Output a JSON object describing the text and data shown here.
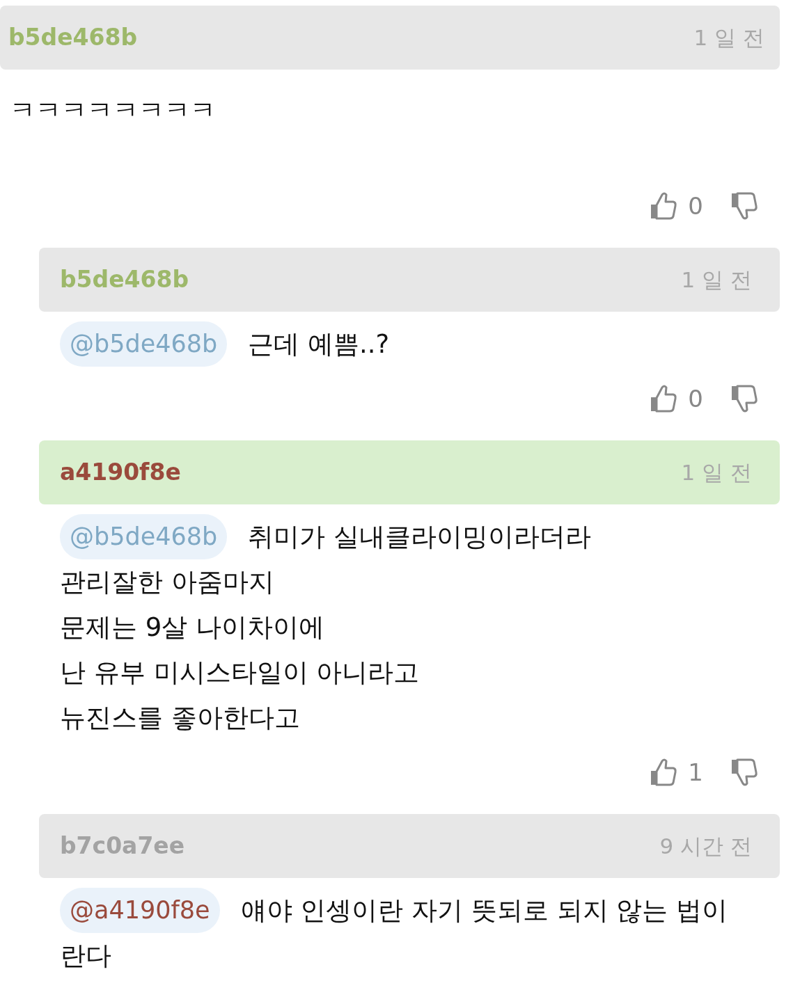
{
  "comments": [
    {
      "author": "b5de468b",
      "color": "#9db86a",
      "time": "1 일 전",
      "reply": false,
      "highlighted": false,
      "lines": [
        "ㅋㅋㅋㅋㅋㅋㅋㅋ"
      ],
      "likes": "0"
    },
    {
      "author": "b5de468b",
      "color": "#9db86a",
      "time": "1 일 전",
      "reply": true,
      "highlighted": false,
      "mention": {
        "text": "@b5de468b",
        "color": "#7fa8c4"
      },
      "lines": [
        "근데 예쁨..?"
      ],
      "likes": "0"
    },
    {
      "author": "a4190f8e",
      "color": "#9a4a3c",
      "time": "1 일 전",
      "reply": true,
      "highlighted": true,
      "mention": {
        "text": "@b5de468b",
        "color": "#7fa8c4"
      },
      "lines": [
        "취미가 실내클라이밍이라더라",
        "관리잘한 아줌마지",
        "문제는 9살 나이차이에",
        "난 유부 미시스타일이 아니라고",
        "뉴진스를 좋아한다고"
      ],
      "likes": "1"
    },
    {
      "author": "b7c0a7ee",
      "color": "#a3a3a3",
      "time": "9 시간 전",
      "reply": true,
      "highlighted": false,
      "mention": {
        "text": "@a4190f8e",
        "color": "#9a4a3c"
      },
      "lines": [
        "얘야 인셍이란 자기 뜻되로 되지 않는 법이",
        "란다"
      ]
    }
  ]
}
